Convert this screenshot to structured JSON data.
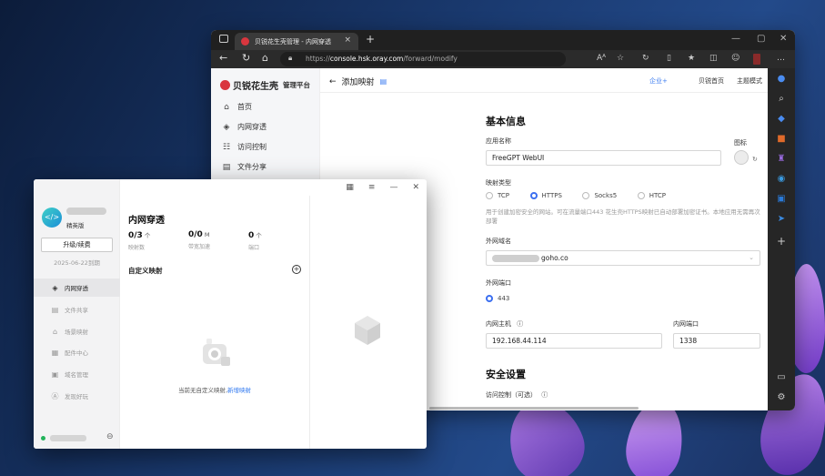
{
  "browser": {
    "tab_title": "贝锐花生壳管理 - 内网穿透",
    "url_prefix": "https://",
    "url_host": "console.hsk.oray.com",
    "url_path": "/forward/modify",
    "reader_label": "Aᴬ"
  },
  "console": {
    "brand": "贝锐花生壳",
    "brand_sub": "管理平台",
    "sidebar": [
      {
        "label": "首页",
        "icon": "home-icon"
      },
      {
        "label": "内网穿透",
        "icon": "tunnel-icon"
      },
      {
        "label": "访问控制",
        "icon": "access-control-icon"
      },
      {
        "label": "文件分享",
        "icon": "file-share-icon"
      }
    ],
    "back_label": "添加映射",
    "header_links": {
      "enterprise": "企业+",
      "home": "贝锐首页",
      "theme": "主题模式"
    },
    "form": {
      "section_basic": "基本信息",
      "app_name_label": "应用名称",
      "app_name_value": "FreeGPT WebUI",
      "icon_label": "图标",
      "mapping_type_label": "映射类型",
      "types": [
        "TCP",
        "HTTPS",
        "Socks5",
        "HTCP"
      ],
      "selected_type": "HTTPS",
      "https_hint": "用于创建加密安全的网站。可在流量端口443 花生壳HTTPS映射已自动部署加密证书。本地应用无需再次部署",
      "domain_label": "外网域名",
      "domain_suffix": "goho.co",
      "port_label": "外网端口",
      "port_value": "443",
      "host_label": "内网主机",
      "host_value": "192.168.44.114",
      "inner_port_label": "内网端口",
      "inner_port_value": "1338",
      "section_security": "安全设置",
      "access_control_label": "访问控制（可选）"
    }
  },
  "app": {
    "edition": "精英版",
    "upgrade_label": "升级/续费",
    "expire": "2025-06-22到期",
    "menu": [
      "内网穿透",
      "文件共享",
      "场景映射",
      "配件中心",
      "域名管理",
      "发现好玩"
    ],
    "title": "内网穿透",
    "stats": [
      {
        "value": "0/3",
        "unit": "个",
        "label": "映射数"
      },
      {
        "value": "0/0",
        "unit": "M",
        "label": "带宽加速"
      },
      {
        "value": "0",
        "unit": "个",
        "label": "端口"
      }
    ],
    "custom_label": "自定义映射",
    "empty_text": "当前无自定义映射,",
    "empty_link": "新增映射"
  }
}
